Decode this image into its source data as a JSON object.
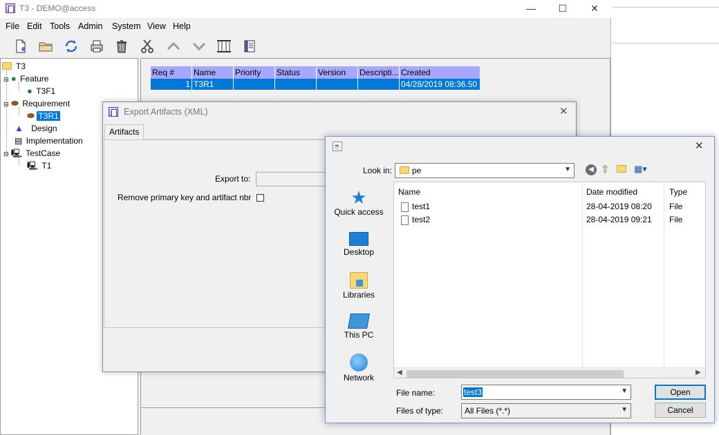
{
  "main_window": {
    "title": "T3 - DEMO@access",
    "controls": {
      "minimize": "—",
      "maximize": "☐",
      "close": "✕"
    },
    "menu": [
      "File",
      "Edit",
      "Tools",
      "Admin",
      "System",
      "View",
      "Help"
    ]
  },
  "toolbar_icons": [
    "new-document-icon",
    "open-folder-icon",
    "refresh-icon",
    "print-icon",
    "trash-icon",
    "cut-icon",
    "move-up-icon",
    "move-down-icon",
    "columns-icon",
    "scroll-icon"
  ],
  "tree": {
    "root": "T3",
    "feature": "Feature",
    "feature_child": "T3F1",
    "requirement": "Requirement",
    "requirement_child": "T3R1",
    "design": "Design",
    "implementation": "Implementation",
    "testcase": "TestCase",
    "testcase_child": "T1"
  },
  "grid": {
    "columns": [
      "Req #",
      "Name",
      "Priority",
      "Status",
      "Version",
      "Descripti...",
      "Created"
    ],
    "rows": [
      [
        "1",
        "T3R1",
        "",
        "",
        "",
        "",
        "04/28/2019 08:36.50"
      ]
    ]
  },
  "export_dialog": {
    "title": "Export Artifacts (XML)",
    "tab": "Artifacts",
    "export_to_label": "Export to:",
    "export_to_value": "",
    "remove_pk_label": "Remove primary key and artifact nbr"
  },
  "file_dialog": {
    "look_in_label": "Look in:",
    "look_in_value": "pe",
    "places": [
      "Quick access",
      "Desktop",
      "Libraries",
      "This PC",
      "Network"
    ],
    "columns": {
      "name": "Name",
      "date": "Date modified",
      "type": "Type"
    },
    "files": [
      {
        "name": "test1",
        "date": "28-04-2019 08:20",
        "type": "File"
      },
      {
        "name": "test2",
        "date": "28-04-2019 09:21",
        "type": "File"
      }
    ],
    "file_name_label": "File name:",
    "file_name_value": "test3",
    "files_of_type_label": "Files of type:",
    "files_of_type_value": "All Files (*.*)",
    "open_label": "Open",
    "cancel_label": "Cancel"
  },
  "colors": {
    "selection": "#0078d7",
    "grid_header": "#a8a6ff"
  }
}
